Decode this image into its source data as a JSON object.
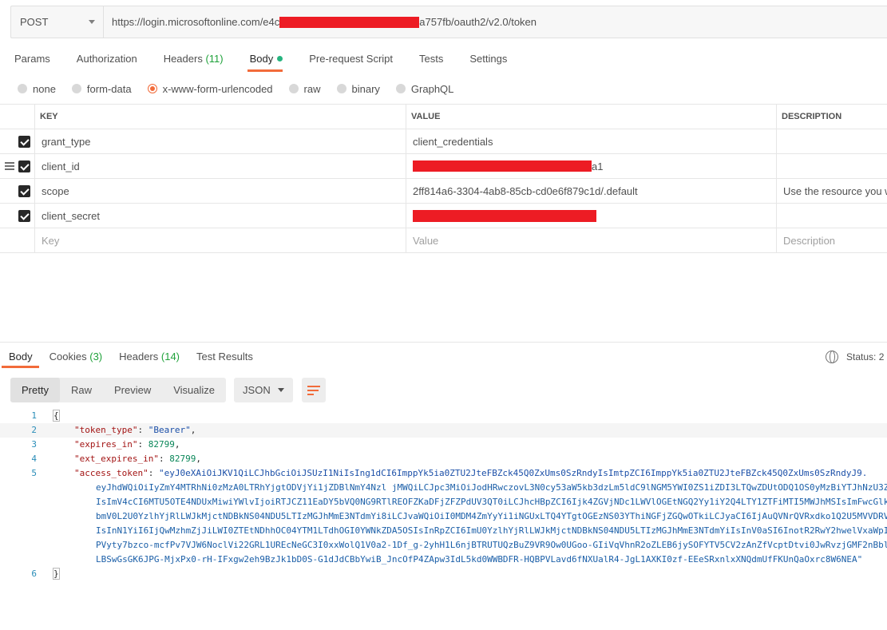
{
  "request": {
    "method": "POST",
    "url_prefix": "https://login.microsoftonline.com/e4c",
    "url_suffix": "a757fb/oauth2/v2.0/token"
  },
  "request_tabs": [
    {
      "label": "Params",
      "count": ""
    },
    {
      "label": "Authorization",
      "count": ""
    },
    {
      "label": "Headers",
      "count": "(11)"
    },
    {
      "label": "Body",
      "count": ""
    },
    {
      "label": "Pre-request Script",
      "count": ""
    },
    {
      "label": "Tests",
      "count": ""
    },
    {
      "label": "Settings",
      "count": ""
    }
  ],
  "body_types": [
    "none",
    "form-data",
    "x-www-form-urlencoded",
    "raw",
    "binary",
    "GraphQL"
  ],
  "params": {
    "headers": {
      "key": "KEY",
      "value": "VALUE",
      "description": "DESCRIPTION"
    },
    "rows": [
      {
        "key": "grant_type",
        "value": "client_credentials",
        "description": ""
      },
      {
        "key": "client_id",
        "value": "a1",
        "description": ""
      },
      {
        "key": "scope",
        "value": "2ff814a6-3304-4ab8-85cb-cd0e6f879c1d/.default",
        "description": "Use the resource you w"
      },
      {
        "key": "client_secret",
        "value": "",
        "description": ""
      }
    ],
    "placeholder": {
      "key": "Key",
      "value": "Value",
      "description": "Description"
    }
  },
  "response_tabs": [
    {
      "label": "Body",
      "count": ""
    },
    {
      "label": "Cookies",
      "count": "(3)"
    },
    {
      "label": "Headers",
      "count": "(14)"
    },
    {
      "label": "Test Results",
      "count": ""
    }
  ],
  "status_label": "Status: 2",
  "view_modes": [
    "Pretty",
    "Raw",
    "Preview",
    "Visualize"
  ],
  "format": "JSON",
  "code": {
    "line_numbers": [
      "1",
      "2",
      "3",
      "4",
      "5",
      "6"
    ],
    "open_brace": "{",
    "close_brace": "}",
    "token_type_key": "\"token_type\"",
    "token_type_val": "\"Bearer\"",
    "expires_in_key": "\"expires_in\"",
    "expires_in_val": "82799",
    "ext_expires_in_key": "\"ext_expires_in\"",
    "ext_expires_in_val": "82799",
    "access_token_key": "\"access_token\"",
    "access_token_lines": [
      "\"eyJ0eXAiOiJKV1QiLCJhbGciOiJSUzI1NiIsIng1dCI6ImppYk5ia0ZTU2JteFBZck45Q0ZxUms0SzRndyIsImtpZCI6ImppYk5ia0ZTU2JteFBZck45Q0ZxUms0SzRndyJ9.",
      "eyJhdWQiOiIyZmY4MTRhNi0zMzA0LTRhYjgtODVjYi1jZDBlNmY4Nzl jMWQiLCJpc3MiOiJodHRwczovL3N0cy53aW5kb3dzLm5ldC9lNGM5YWI0ZS1iZDI3LTQwZDUtODQ1OS0yMzBiYTJhNzU3ZmI",
      "IsImV4cCI6MTU5OTE4NDUxMiwiYWlvIjoiRTJCZ11EaDY5bVQ0NG9RTlREOFZKaDFjZFZPdUV3QT0iLCJhcHBpZCI6Ijk4ZGVjNDc1LWVlOGEtNGQ2Yy1iY2Q4LTY1ZTFiMTI5MWJhMSIsImFwcGlkYWNy",
      "bmV0L2U0YzlhYjRlLWJkMjctNDBkNS04NDU5LTIzMGJhMmE3NTdmYi8iLCJvaWQiOiI0MDM4ZmYyYi1iNGUxLTQ4YTgtOGEzNS03YThiNGFjZGQwOTkiLCJyaCI6IjAuQVNrQVRxdko1Q2U5MVVDRV",
      "IsInN1YiI6IjQwMzhmZjJiLWI0ZTEtNDhhOC04YTM1LTdhOGI0YWNkZDA5OSIsInRpZCI6ImU0YzlhYjRlLWJkMjctNDBkNS04NDU5LTIzMGJhMmE3NTdmYiIsInV0aSI6InotR2RwY2hwelVxaWpIN",
      "PVyty7bzco-mcfPv7VJW6NoclVi22GRL1UREcNeGC3I0xxWolQ1V0a2-1Df_g-2yhH1L6njBTRUTUQzBuZ9VR9Ow0UGoo-GIiVqVhnR2oZLEB6jySOFYTV5CV2zAnZfVcptDtvi0JwRvzjGMF2nBbl",
      "LBSwGsGK6JPG-MjxPx0-rH-IFxgw2eh9BzJk1bD0S-G1dJdCBbYwiB_JncOfP4ZApw3IdL5kd0WWBDFR-HQBPVLavd6fNXUalR4-JgL1AXKI0zf-EEeSRxnlxXNQdmUfFKUnQaOxrc8W6NEA\""
    ]
  },
  "colors": {
    "accent": "#f26b3a",
    "count_green": "#20a23b",
    "dot_green": "#26b47f",
    "redaction": "#ed1c24"
  }
}
